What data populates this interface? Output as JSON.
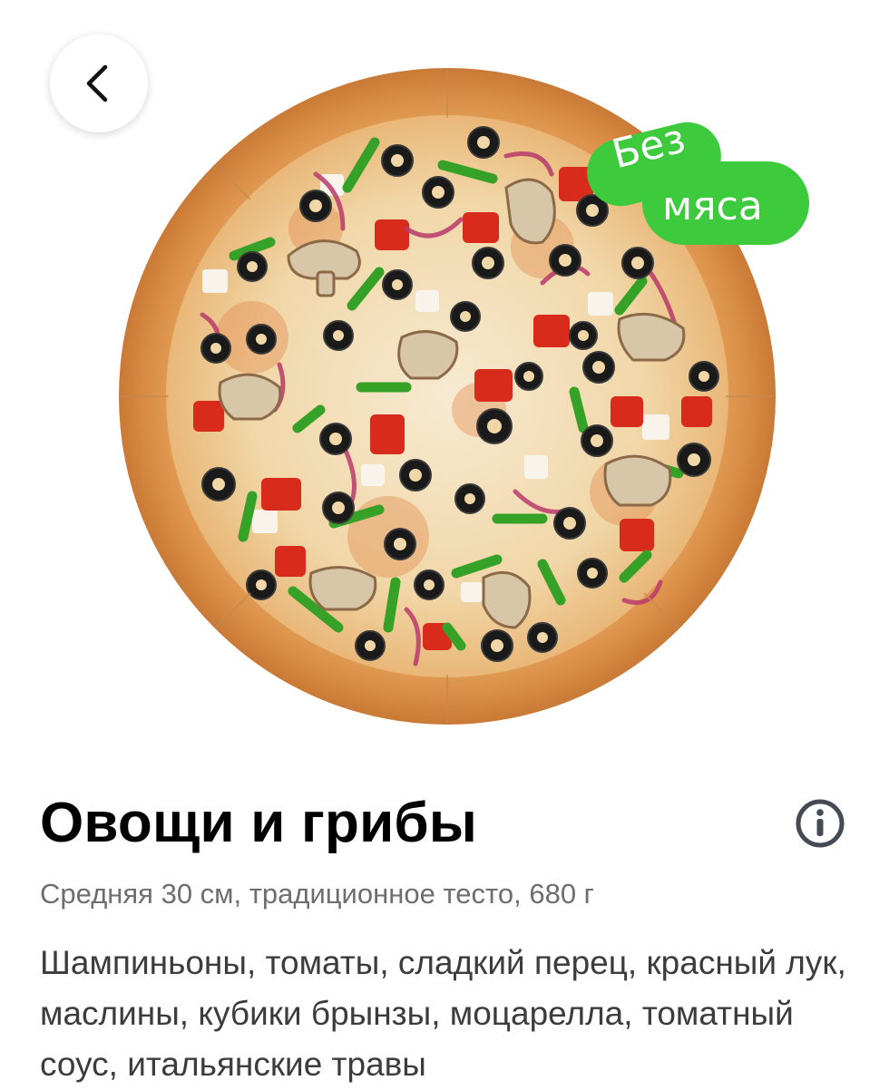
{
  "back_button": {
    "icon": "chevron-left-icon"
  },
  "badge": {
    "line1": "Без",
    "line2": "мяса",
    "color": "#3dca3d"
  },
  "product": {
    "title": "Овощи и грибы",
    "subtitle": "Средняя 30 см, традиционное тесто, 680 г",
    "description": "Шампиньоны, томаты, сладкий перец, красный лук, маслины, кубики брынзы, моцарелла, томатный соус, итальянские травы"
  },
  "info_button": {
    "icon": "info-icon"
  }
}
